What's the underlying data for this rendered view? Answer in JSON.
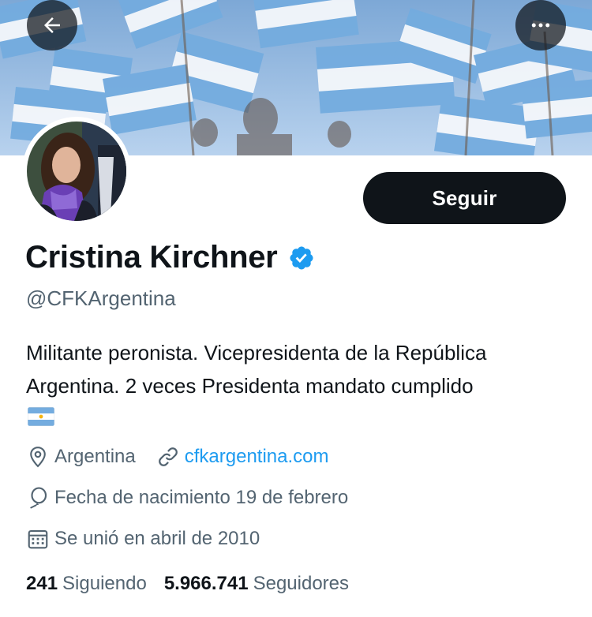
{
  "header": {
    "back_icon": "arrow-left-icon",
    "more_icon": "more-horizontal-icon",
    "banner_image": "crowd-waving-argentine-flags"
  },
  "profile": {
    "avatar_image": "woman-in-purple-scarf",
    "follow_label": "Seguir",
    "display_name": "Cristina Kirchner",
    "verified_icon": "verified-badge-icon",
    "handle": "@CFKArgentina",
    "bio_line_1": "Militante peronista. Vicepresidenta de la República",
    "bio_line_2": "Argentina. 2 veces Presidenta mandato cumplido",
    "bio_emoji": "argentina-flag-emoji"
  },
  "meta": {
    "location_icon": "map-pin-icon",
    "location": "Argentina",
    "link_icon": "link-icon",
    "website": "cfkargentina.com",
    "birth_icon": "balloon-icon",
    "birthday": "Fecha de nacimiento 19 de febrero",
    "joined_icon": "calendar-icon",
    "joined": "Se unió en abril de 2010"
  },
  "stats": {
    "following_count": "241",
    "following_label": "Siguiendo",
    "followers_count": "5.966.741",
    "followers_label": "Seguidores"
  },
  "colors": {
    "text_primary": "#0f1419",
    "text_secondary": "#536471",
    "link": "#1d9bf0",
    "button_bg": "#0f1419",
    "flag_blue": "#74acdf"
  }
}
